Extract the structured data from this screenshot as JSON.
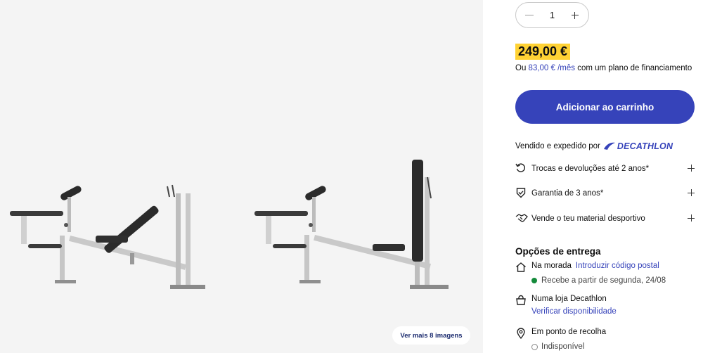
{
  "gallery": {
    "more_images_label": "Ver mais 8 imagens"
  },
  "product": {
    "quantity": "1",
    "price": "249,00 €",
    "financing": {
      "prefix": "Ou",
      "monthly_amount": "83,00 € /mês",
      "suffix": "com um plano de financiamento"
    },
    "add_to_cart_label": "Adicionar ao carrinho",
    "sold_by": "Vendido e expedido por",
    "brand": "DECATHLON"
  },
  "services": [
    {
      "label": "Trocas e devoluções até 2 anos*",
      "icon": "return-arrow-icon"
    },
    {
      "label": "Garantia de 3 anos*",
      "icon": "shield-check-icon"
    },
    {
      "label": "Vende o teu material desportivo",
      "icon": "handshake-icon"
    }
  ],
  "delivery": {
    "title": "Opções de entrega",
    "home": {
      "label": "Na morada",
      "link": "Introduzir código postal",
      "status": "Recebe a partir de segunda, 24/08"
    },
    "store": {
      "label": "Numa loja Decathlon",
      "link": "Verificar disponibilidade"
    },
    "pickup": {
      "label": "Em ponto de recolha",
      "status": "Indisponível"
    }
  },
  "colors": {
    "brand_blue": "#3643ba",
    "price_highlight": "#ffd234",
    "available_green": "#148a3a"
  }
}
